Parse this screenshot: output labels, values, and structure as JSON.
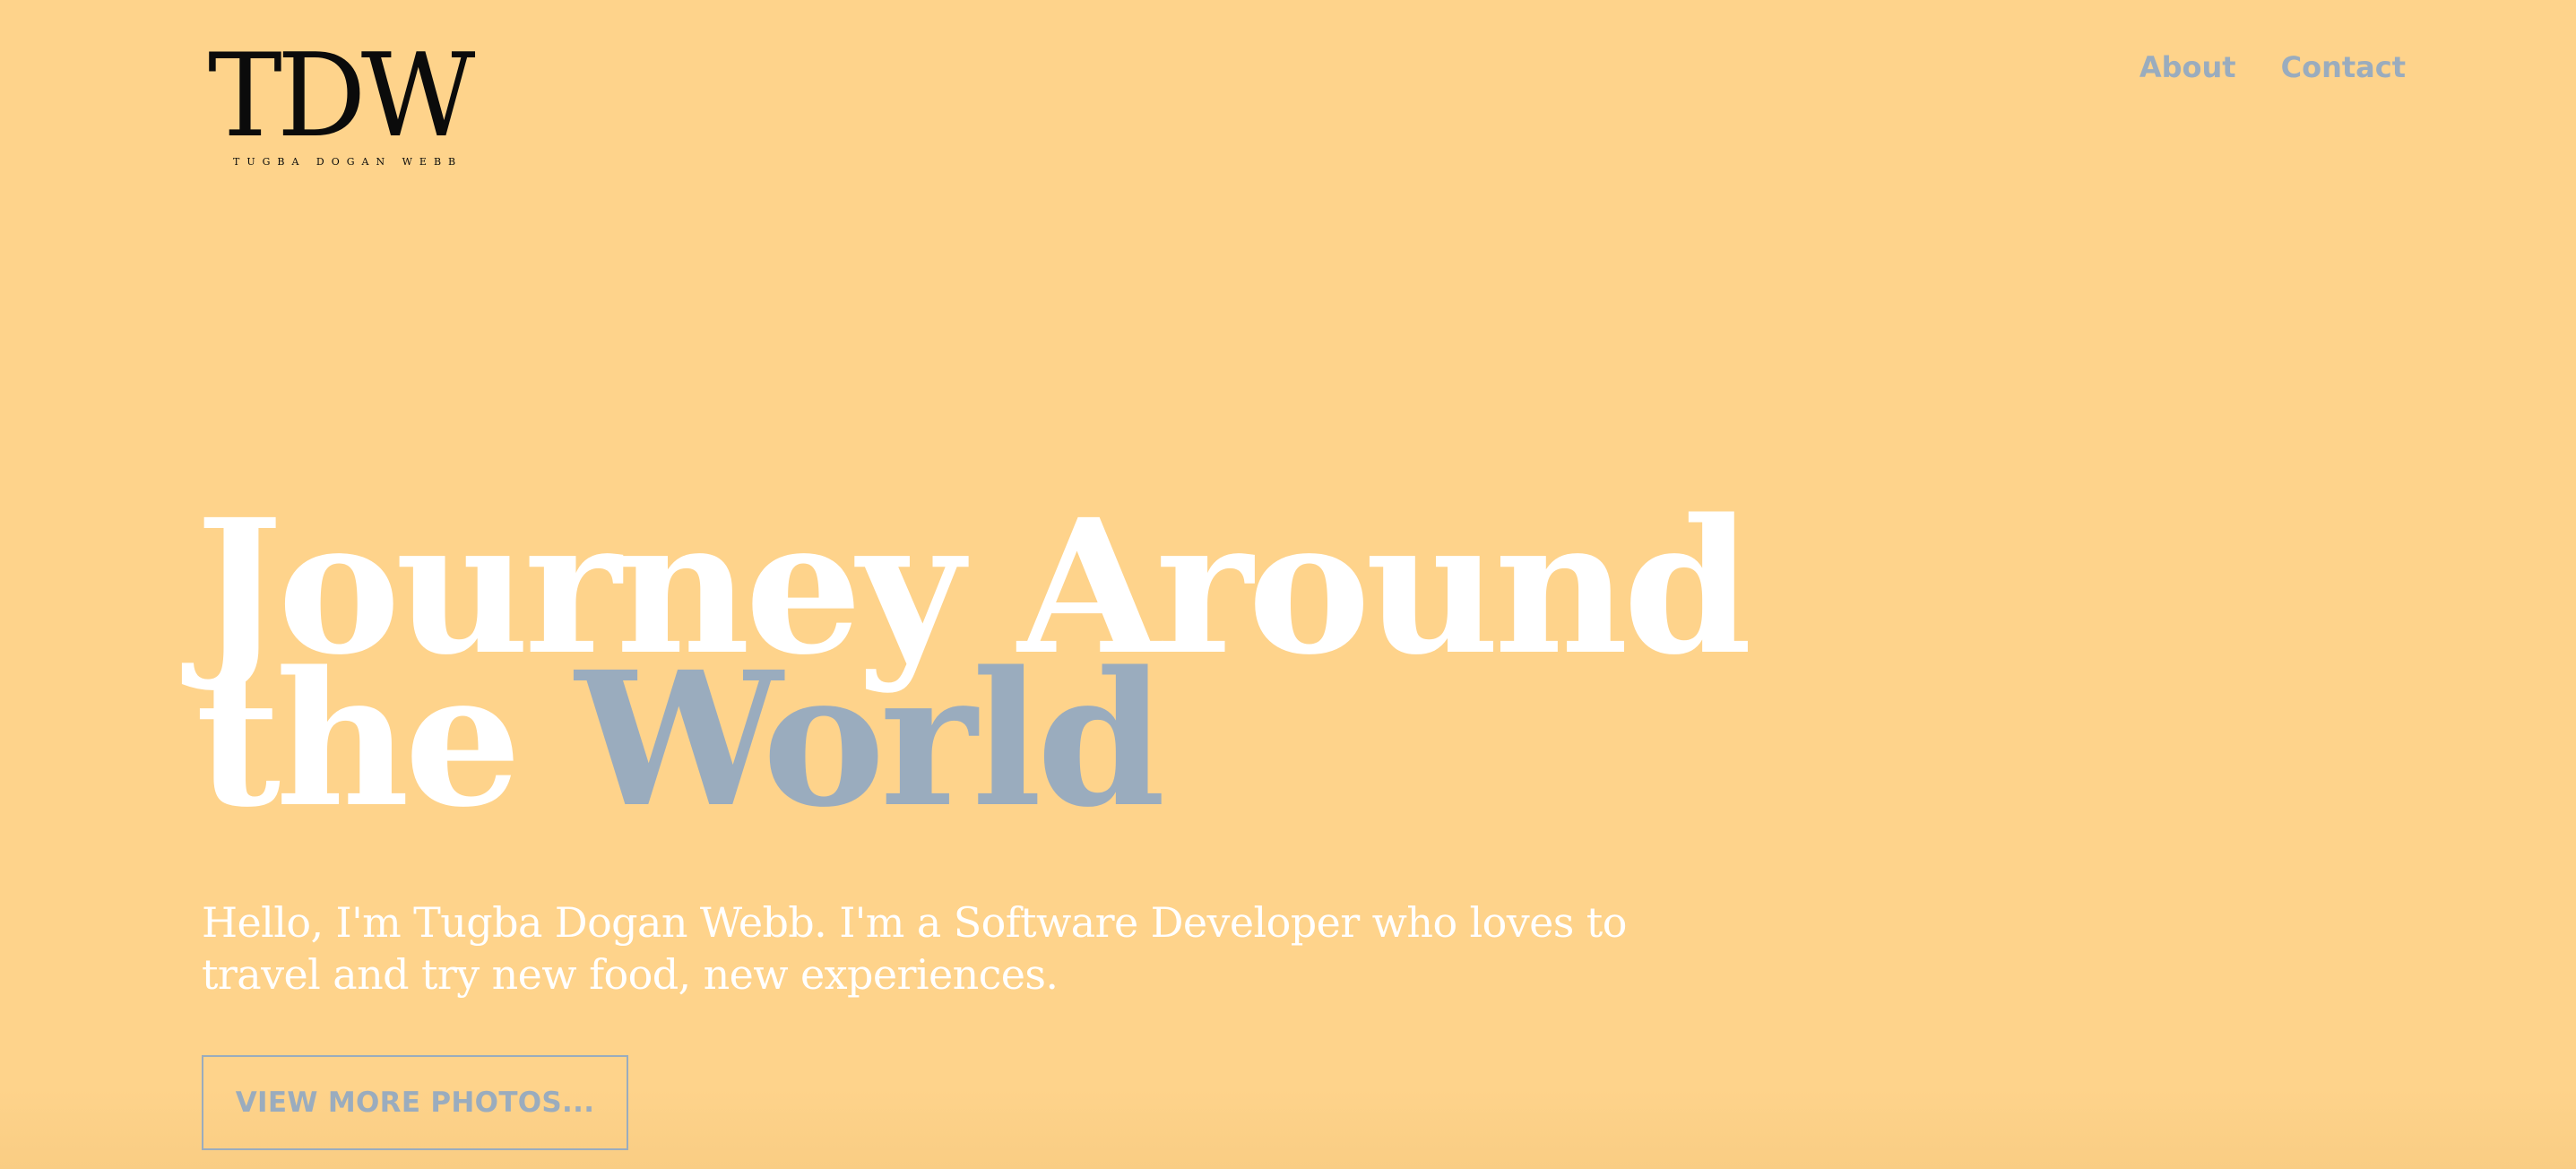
{
  "logo": {
    "mark": "TDW",
    "name": "TUGBA DOGAN WEBB"
  },
  "nav": {
    "about": "About",
    "contact": "Contact"
  },
  "hero": {
    "title_line1": "Journey Around",
    "title_line2_plain": "the",
    "title_line2_accent": "World",
    "subtitle": "Hello, I'm Tugba Dogan Webb. I'm a Software Developer who loves to travel and try new food, new experiences.",
    "cta_label": "VIEW MORE PHOTOS..."
  },
  "colors": {
    "background": "#fed38b",
    "accent": "#9aacbe",
    "text_light": "#ffffff",
    "logo": "#0b0b0b"
  }
}
